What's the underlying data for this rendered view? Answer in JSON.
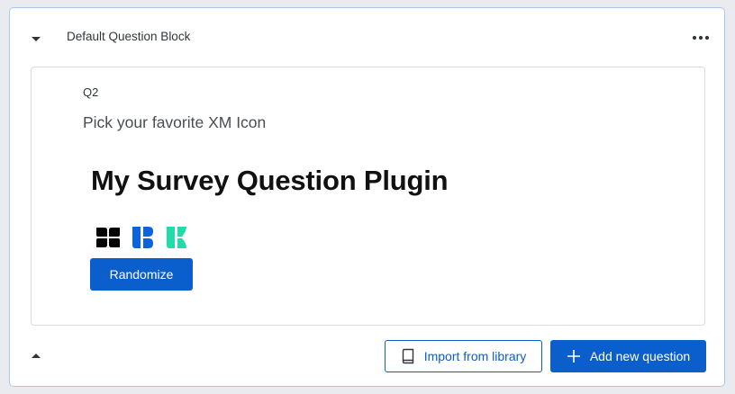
{
  "block": {
    "title": "Default Question Block",
    "collapse_icon": "caret-down-icon",
    "more_icon": "more-horizontal-icon",
    "expand_icon": "caret-up-icon"
  },
  "question": {
    "number": "Q2",
    "text": "Pick your favorite XM Icon",
    "plugin_title": "My Survey Question Plugin",
    "icons": [
      {
        "name": "xm-black-icon",
        "color": "#000000"
      },
      {
        "name": "xm-blue-icon",
        "color": "#0b63dd"
      },
      {
        "name": "xm-green-icon",
        "color": "#21dbaa"
      }
    ],
    "randomize_label": "Randomize"
  },
  "footer": {
    "import_label": "Import from library",
    "import_icon": "book-icon",
    "add_label": "Add new question",
    "add_icon": "plus-icon"
  },
  "colors": {
    "accent": "#0b5fcc",
    "block_border": "#a9c9ec",
    "card_border": "#d9dcdf"
  }
}
